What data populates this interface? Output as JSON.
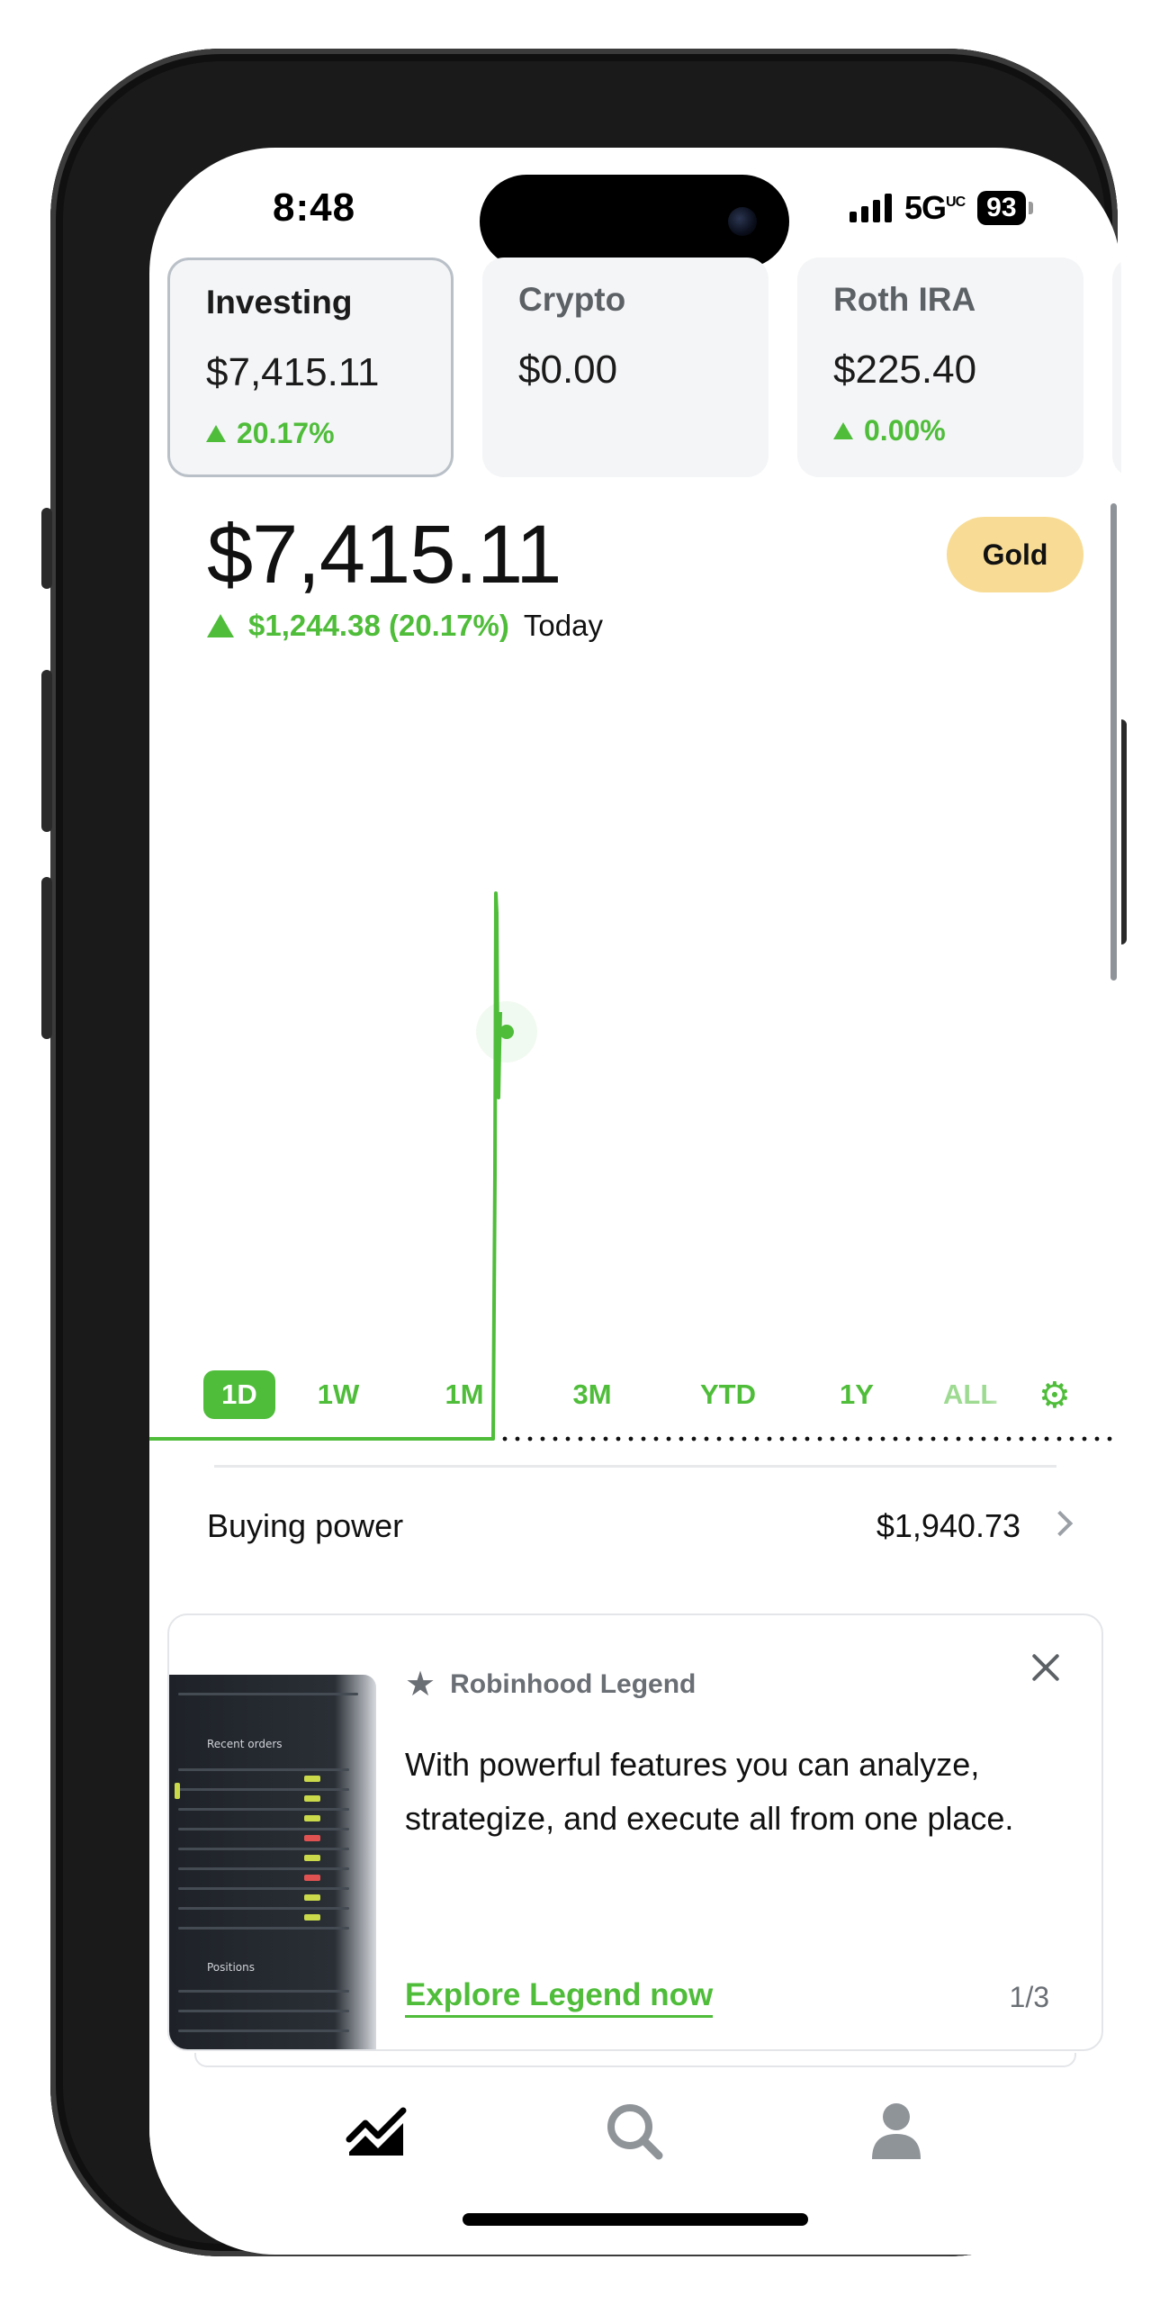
{
  "status_bar": {
    "time": "8:48",
    "network": "5G",
    "network_suffix": "UC",
    "battery": "93"
  },
  "accounts": [
    {
      "name": "Investing",
      "value": "$7,415.11",
      "change": "20.17%",
      "selected": true
    },
    {
      "name": "Crypto",
      "value": "$0.00",
      "change": ""
    },
    {
      "name": "Roth IRA",
      "value": "$225.40",
      "change": "0.00%"
    }
  ],
  "portfolio": {
    "value": "$7,415.11",
    "badge": "Gold",
    "change_amount": "$1,244.38 (20.17%)",
    "change_period": "Today"
  },
  "chart": {
    "accent": "#4fbd3a",
    "day_progress": 0.355
  },
  "ranges": {
    "items": [
      "1D",
      "1W",
      "1M",
      "3M",
      "YTD",
      "1Y",
      "ALL"
    ],
    "active": "1D"
  },
  "buying_power": {
    "label": "Buying power",
    "value": "$1,940.73"
  },
  "promo": {
    "brand": "Robinhood Legend",
    "body": "With powerful features you can analyze, strategize, and execute all from one place.",
    "cta": "Explore Legend now",
    "page": "1/3",
    "thumb_heading": "Recent orders",
    "thumb_heading2": "Positions"
  },
  "tabbar": {
    "items": [
      "chart-icon",
      "search-icon",
      "account-icon"
    ]
  },
  "colors": {
    "accent": "#4fbd3a",
    "gold": "#f8dc95",
    "text": "#111111",
    "muted": "#6a6f75"
  }
}
